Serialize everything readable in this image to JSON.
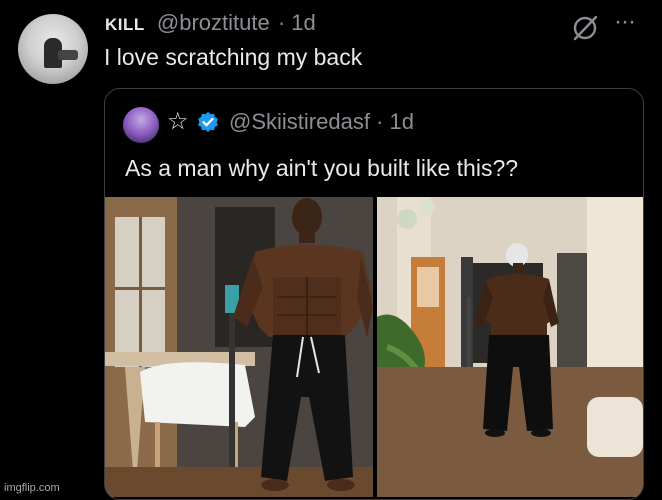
{
  "tweet": {
    "display_name": "KILL",
    "handle": "@broztitute",
    "time": "· 1d",
    "text": "I love scratching my back"
  },
  "quoted": {
    "handle": "@Skiistiredasf",
    "time": "· 1d",
    "text": "As a man why ain't you built like this??",
    "badge_color": "#1d9bf0"
  },
  "icons": {
    "grok": "grok-icon",
    "more": "more-icon",
    "star": "star-icon",
    "verified": "verified-badge-icon"
  },
  "watermark": "imgflip.com"
}
